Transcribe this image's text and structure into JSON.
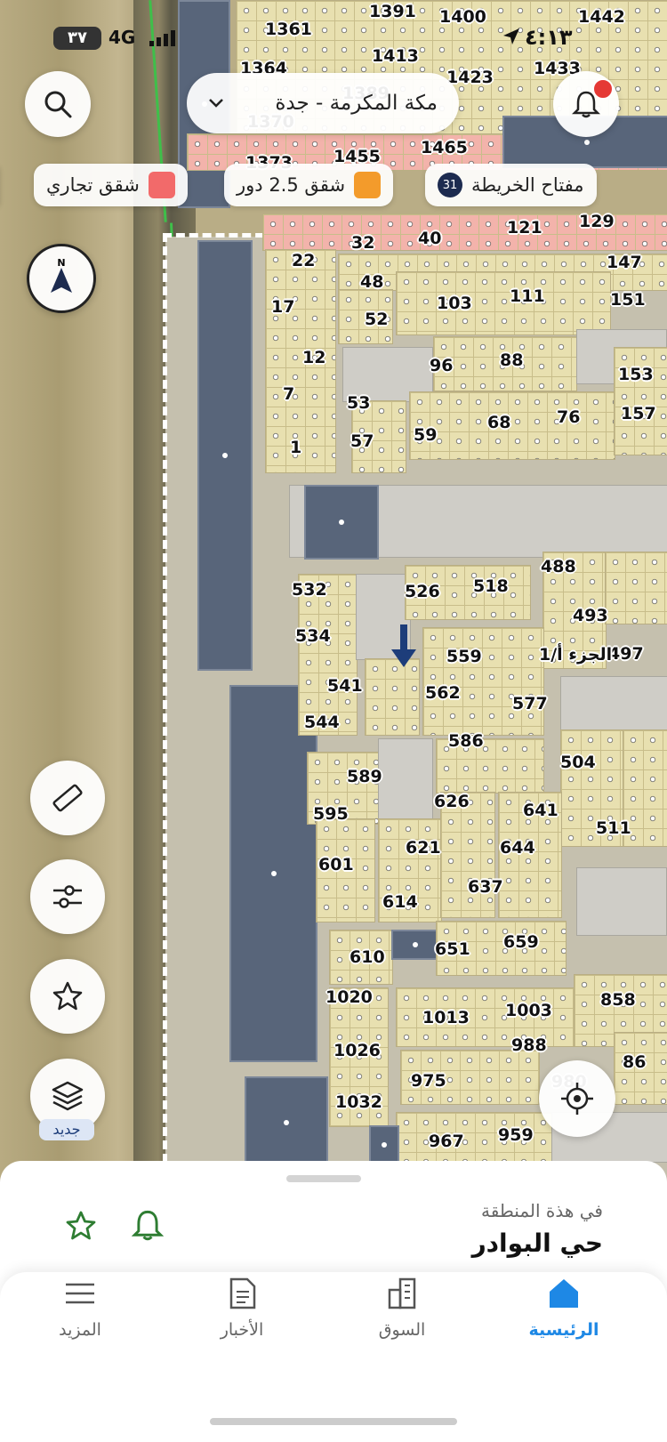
{
  "status_bar": {
    "time": "٤:١٣",
    "network": "4G",
    "battery": "٣٧"
  },
  "search": {
    "city_selector": "مكة المكرمة - جدة"
  },
  "legend_chips": [
    {
      "label": "مفتاح الخريطة",
      "badge": "31"
    },
    {
      "label": "شقق 2.5 دور",
      "color": "#f39b2b"
    },
    {
      "label": "شقق تجاري",
      "color": "#f26a6a"
    }
  ],
  "map_labels": [
    "1361",
    "1391",
    "1400",
    "1442",
    "1364",
    "1413",
    "1433",
    "1423",
    "1389",
    "1370",
    "1373",
    "1455",
    "1465",
    "121",
    "129",
    "40",
    "32",
    "22",
    "147",
    "48",
    "17",
    "103",
    "111",
    "151",
    "52",
    "12",
    "96",
    "88",
    "153",
    "7",
    "53",
    "68",
    "76",
    "157",
    "57",
    "59",
    "1",
    "488",
    "526",
    "518",
    "532",
    "493",
    "534",
    "559",
    "497",
    "الجزء أ/1",
    "541",
    "562",
    "577",
    "544",
    "586",
    "504",
    "589",
    "626",
    "641",
    "595",
    "511",
    "621",
    "644",
    "601",
    "637",
    "614",
    "651",
    "659",
    "610",
    "1020",
    "1013",
    "1003",
    "858",
    "988",
    "1026",
    "86",
    "975",
    "1032",
    "967",
    "959",
    "980"
  ],
  "tools": {
    "new_badge": "جديد"
  },
  "bottom_sheet": {
    "subtitle": "في هذة المنطقة",
    "title": "حي البوادر"
  },
  "nav": [
    {
      "label": "الرئيسية",
      "active": true
    },
    {
      "label": "السوق",
      "active": false
    },
    {
      "label": "الأخبار",
      "active": false
    },
    {
      "label": "المزيد",
      "active": false
    }
  ],
  "colors": {
    "accent": "#1e88e5",
    "alert": "#e53935",
    "star": "#2e7d32"
  }
}
